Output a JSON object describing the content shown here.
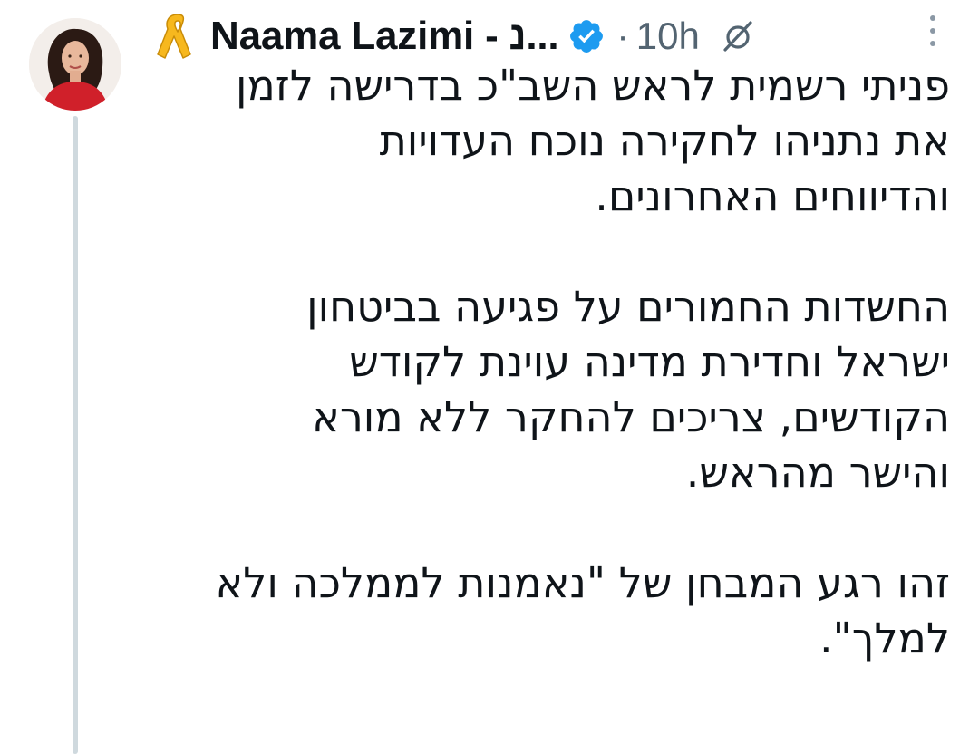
{
  "author": {
    "display_name": "Naama Lazimi - נ...",
    "verified": true,
    "verified_color": "#1d9bf0",
    "avatar_icon": "profile-photo",
    "name_prefix_icon": "yellow-ribbon-emoji"
  },
  "meta": {
    "separator": "·",
    "time": "10h"
  },
  "icons": {
    "grok": "grok-slash-icon",
    "more": "more-vertical-icon"
  },
  "tweet": {
    "paragraphs": [
      {
        "lines": [
          "פניתי רשמית לראש השב\"כ בדרישה לזמן",
          "את נתניהו לחקירה נוכח העדויות",
          "והדיווחים האחרונים."
        ]
      },
      {
        "lines": [
          "החשדות החמורים על פגיעה בביטחון",
          "ישראל וחדירת מדינה עוינת לקודש",
          "הקודשים, צריכים להחקר ללא מורא",
          "והישר מהראש."
        ]
      },
      {
        "lines": [
          "זהו רגע המבחן של \"נאמנות לממלכה ולא",
          "למלך\"."
        ]
      }
    ]
  }
}
